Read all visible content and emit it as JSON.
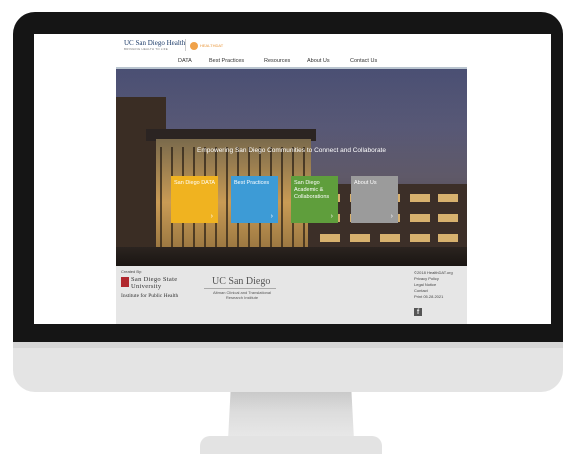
{
  "header": {
    "logo_text": "UC San Diego Health",
    "logo_subtext": "BRINGING HEALTH TO LIFE",
    "partner_logo_text": "HEALTHDAT"
  },
  "nav": {
    "items": [
      "DATA",
      "Best Practices",
      "Resources",
      "About Us",
      "Contact Us"
    ]
  },
  "hero": {
    "heading": "Empowering San Diego Communities to Connect and Collaborate",
    "tiles": [
      {
        "label": "San Diego DATA",
        "color": "#f0b320"
      },
      {
        "label": "Best Practices",
        "color": "#3d9bd6"
      },
      {
        "label": "San Diego Academic & Collaborations",
        "color": "#5f9e3c"
      },
      {
        "label": "About Us",
        "color": "#9b9b9b"
      }
    ],
    "tile_arrow": "›"
  },
  "footer": {
    "created_by": "Created By:",
    "sdsu_line1": "San Diego State",
    "sdsu_line2": "University",
    "sdsu_institute": "Institute for Public Health",
    "ucsd": "UC San Diego",
    "altman_line1": "Altman Clinical and Translational",
    "altman_line2": "Research Institute",
    "links": [
      "©2018 HealthDAT.org",
      "Privacy Policy",
      "Legal Notice",
      "Contact",
      "Print 05.28.2021"
    ],
    "facebook_glyph": "f"
  }
}
